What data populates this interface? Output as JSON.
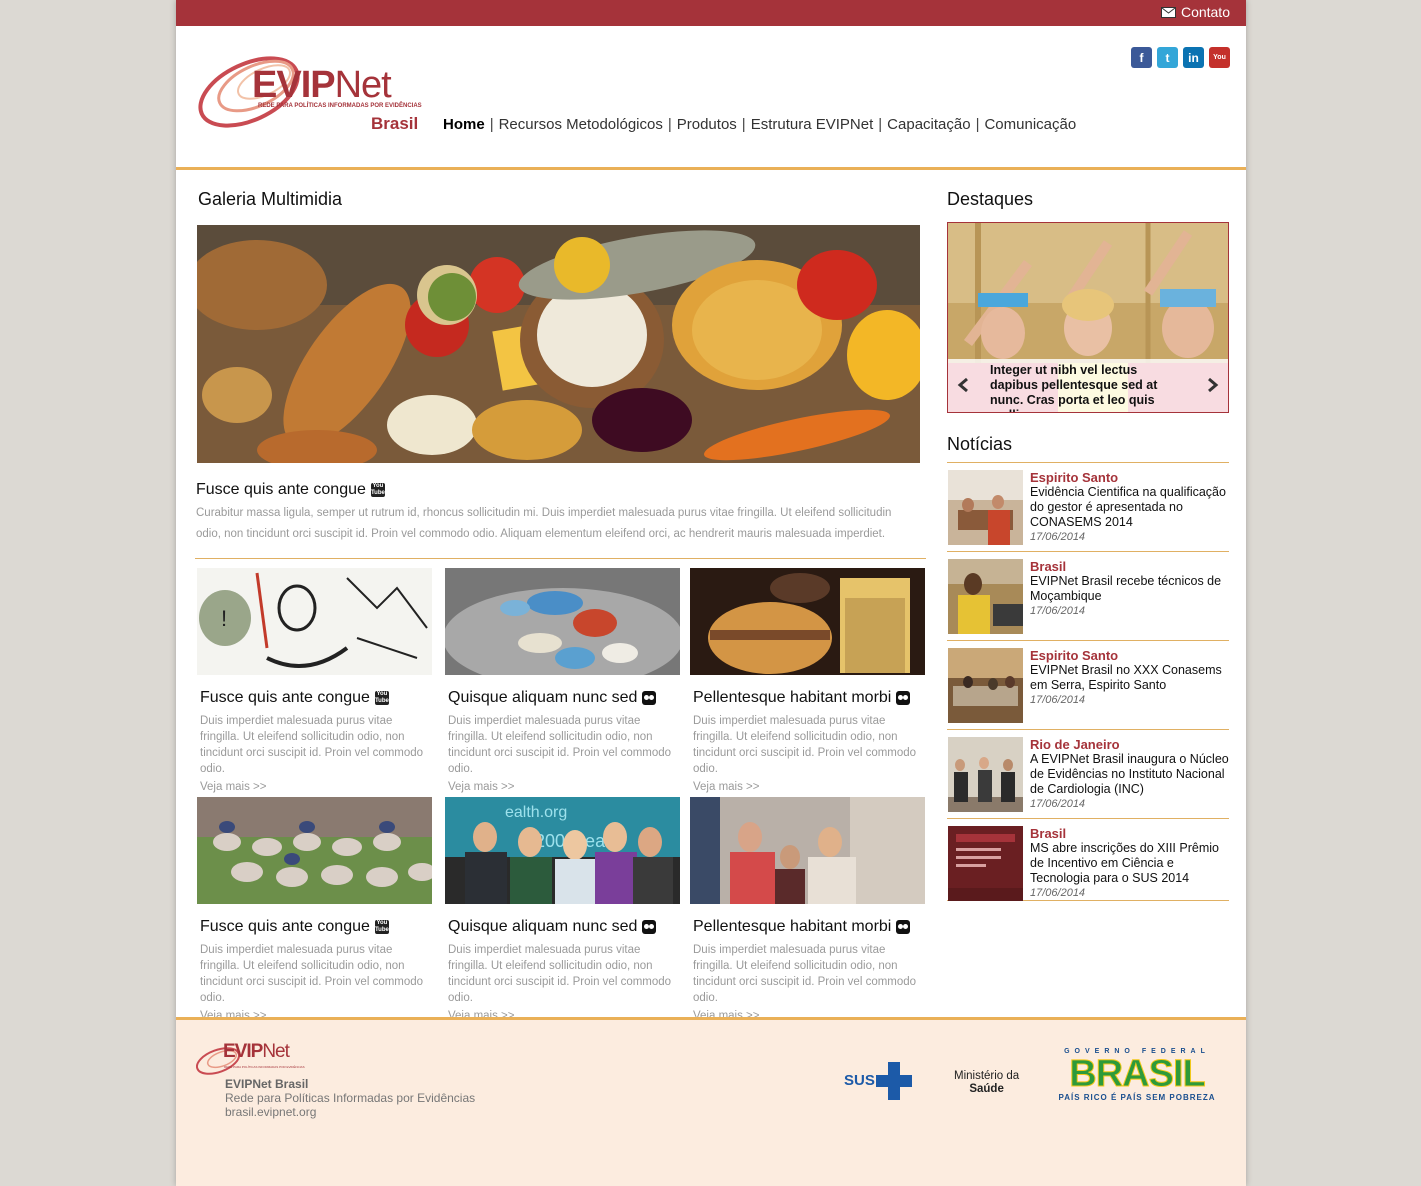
{
  "topbar": {
    "contact_label": "Contato"
  },
  "logo": {
    "name_evip": "EVIP",
    "name_net": "Net",
    "tagline": "REDE PARA POLÍTICAS INFORMADAS POR EVIDÊNCIAS",
    "country": "Brasil"
  },
  "social": [
    {
      "icon": "facebook-icon",
      "glyph": "f",
      "color": "#3b5998"
    },
    {
      "icon": "twitter-icon",
      "glyph": "t",
      "color": "#33a6d8"
    },
    {
      "icon": "linkedin-icon",
      "glyph": "in",
      "color": "#0b73b2"
    },
    {
      "icon": "youtube-icon",
      "glyph": "You",
      "color": "#c4302b"
    }
  ],
  "nav": {
    "items": [
      "Home",
      "Recursos Metodológicos",
      "Produtos",
      "Estrutura EVIPNet",
      "Capacitação",
      "Comunicação"
    ],
    "active": "Home"
  },
  "gallery": {
    "heading": "Galeria Multimidia",
    "featured": {
      "title": "Fusce quis ante congue",
      "text": "Curabitur massa ligula, semper ut rutrum id, rhoncus sollicitudin mi. Duis imperdiet malesuada purus vitae fringilla. Ut eleifend sollicitudin odio, non tincidunt orci suscipit id. Proin vel commodo odio. Aliquam elementum eleifend orci, ac hendrerit mauris malesuada imperdiet."
    },
    "cards": [
      {
        "title": "Fusce quis ante congue",
        "icon": "youtube-icon",
        "text": "Duis imperdiet malesuada purus vitae fringilla. Ut eleifend sollicitudin odio, non tincidunt orci suscipit id. Proin vel commodo odio.",
        "more": "Veja mais >>"
      },
      {
        "title": "Quisque aliquam nunc sed",
        "icon": "flickr-icon",
        "text": "Duis imperdiet malesuada purus vitae fringilla. Ut eleifend sollicitudin odio, non tincidunt orci suscipit id. Proin vel commodo odio.",
        "more": "Veja mais >>"
      },
      {
        "title": "Pellentesque habitant morbi",
        "icon": "flickr-icon",
        "text": "Duis imperdiet malesuada purus vitae fringilla. Ut eleifend sollicitudin odio, non tincidunt orci suscipit id. Proin vel commodo odio.",
        "more": "Veja mais >>"
      },
      {
        "title": "Fusce quis ante congue",
        "icon": "youtube-icon",
        "text": "Duis imperdiet malesuada purus vitae fringilla. Ut eleifend sollicitudin odio, non tincidunt orci suscipit id. Proin vel commodo odio.",
        "more": "Veja mais >>"
      },
      {
        "title": "Quisque aliquam nunc sed",
        "icon": "flickr-icon",
        "text": "Duis imperdiet malesuada purus vitae fringilla. Ut eleifend sollicitudin odio, non tincidunt orci suscipit id. Proin vel commodo odio.",
        "more": "Veja mais >>"
      },
      {
        "title": "Pellentesque habitant morbi",
        "icon": "flickr-icon",
        "text": "Duis imperdiet malesuada purus vitae fringilla. Ut eleifend sollicitudin odio, non tincidunt orci suscipit id. Proin vel commodo odio.",
        "more": "Veja mais >>"
      }
    ]
  },
  "destaques": {
    "heading": "Destaques",
    "caption": "Integer ut nibh vel lectus dapibus pellentesque sed at nunc. Cras porta et leo quis mollis"
  },
  "noticias": {
    "heading": "Notícias",
    "items": [
      {
        "region": "Espirito Santo",
        "headline": "Evidência Cientifica na qualificação do gestor é apresentada no CONASEMS 2014",
        "date": "17/06/2014"
      },
      {
        "region": "Brasil",
        "headline": "EVIPNet Brasil recebe técnicos de Moçambique",
        "date": "17/06/2014"
      },
      {
        "region": "Espirito Santo",
        "headline": "EVIPNet Brasil no XXX Conasems em Serra, Espirito Santo",
        "date": "17/06/2014"
      },
      {
        "region": "Rio de Janeiro",
        "headline": "A EVIPNet Brasil inaugura o Núcleo de Evidências no Instituto Nacional de Cardiologia (INC)",
        "date": "17/06/2014"
      },
      {
        "region": "Brasil",
        "headline": "MS abre inscrições do XIII Prêmio de Incentivo em Ciência e Tecnologia para o SUS 2014",
        "date": "17/06/2014"
      }
    ]
  },
  "footer": {
    "brand": "EVIPNet Brasil",
    "tagline": "Rede para Políticas Informadas por Evidências",
    "url": "brasil.evipnet.org",
    "sus": "SUS",
    "ministerio_line1": "Ministério da",
    "ministerio_line2": "Saúde",
    "gov_top": "GOVERNO FEDERAL",
    "gov_name": "BRASIL",
    "gov_motto": "PAÍS RICO É PAÍS SEM POBREZA"
  },
  "colors": {
    "brand_red": "#a5333a",
    "accent_orange": "#eab057",
    "footer_bg": "#fcecdf"
  }
}
